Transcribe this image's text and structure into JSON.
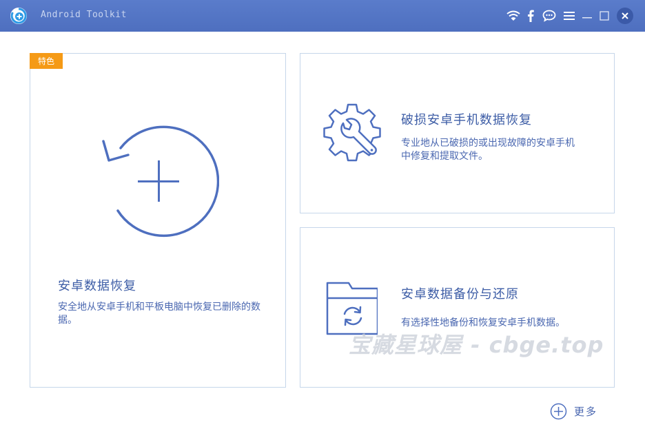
{
  "window": {
    "title": "Android Toolkit",
    "controls": [
      "wifi-icon",
      "facebook-icon",
      "chat-icon",
      "menu-icon",
      "minimize-icon",
      "maximize-icon",
      "close-icon"
    ]
  },
  "colors": {
    "titlebar": "#5476c6",
    "accent": "#4e6fbf",
    "badge": "#f59a16",
    "card_border": "#c5d6ea"
  },
  "cards": {
    "main": {
      "badge": "特色",
      "title": "安卓数据恢复",
      "description": "安全地从安卓手机和平板电脑中恢复已删除的数据。"
    },
    "repair": {
      "title": "破损安卓手机数据恢复",
      "description": "专业地从已破损的或出现故障的安卓手机中修复和提取文件。"
    },
    "backup": {
      "title": "安卓数据备份与还原",
      "description": "有选择性地备份和恢复安卓手机数据。"
    }
  },
  "watermark": "宝藏星球屋 - cbge.top",
  "more": {
    "label": "更多"
  }
}
